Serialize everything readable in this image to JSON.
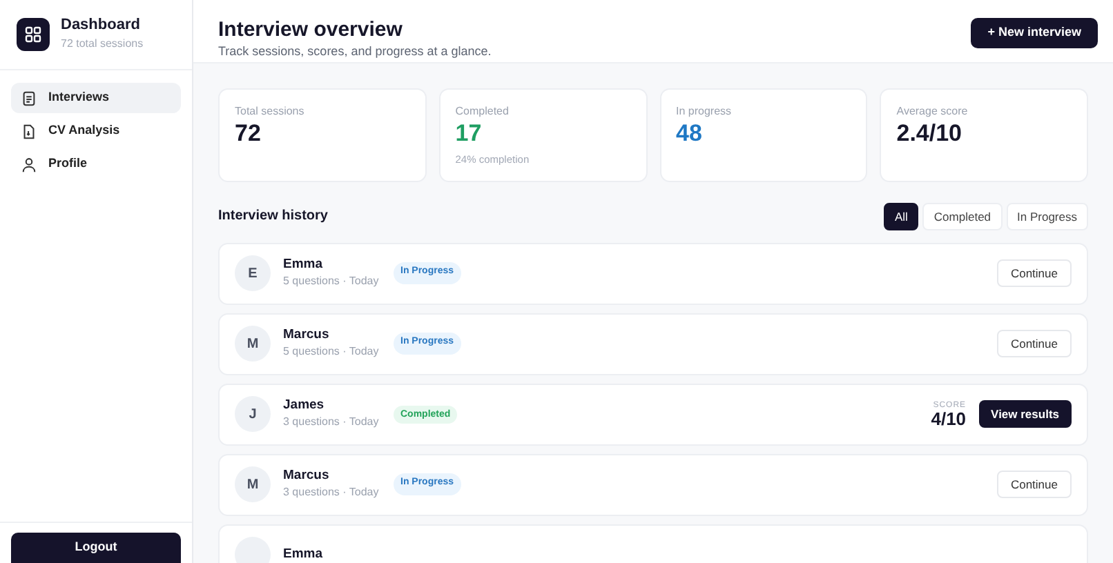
{
  "sidebar": {
    "title": "Dashboard",
    "subtitle": "72 total sessions",
    "items": [
      {
        "label": "Interviews",
        "selected": true
      },
      {
        "label": "CV Analysis",
        "selected": false
      },
      {
        "label": "Profile",
        "selected": false
      }
    ],
    "logout": "Logout"
  },
  "header": {
    "title": "Interview overview",
    "subtitle": "Track sessions, scores, and progress at a glance.",
    "action": "+ New interview"
  },
  "stats": [
    {
      "label": "Total sessions",
      "value": "72",
      "color": "#161629"
    },
    {
      "label": "Completed",
      "value": "17",
      "color": "#1f9e62",
      "note": "24% completion"
    },
    {
      "label": "In progress",
      "value": "48",
      "color": "#1f78c4"
    },
    {
      "label": "Average score",
      "value": "2.4/10",
      "color": "#161629"
    }
  ],
  "history": {
    "title": "Interview history",
    "filters": [
      {
        "label": "All",
        "selected": true
      },
      {
        "label": "Completed",
        "selected": false
      },
      {
        "label": "In Progress",
        "selected": false
      }
    ],
    "rows": [
      {
        "initial": "E",
        "name": "Emma",
        "meta": "5 questions · Today",
        "status": "In Progress",
        "kind": "progress",
        "action": "Continue"
      },
      {
        "initial": "M",
        "name": "Marcus",
        "meta": "5 questions · Today",
        "status": "In Progress",
        "kind": "progress",
        "action": "Continue"
      },
      {
        "initial": "J",
        "name": "James",
        "meta": "3 questions · Today",
        "status": "Completed",
        "kind": "completed",
        "score_label": "SCORE",
        "score": "4/10",
        "action": "View results"
      },
      {
        "initial": "M",
        "name": "Marcus",
        "meta": "3 questions · Today",
        "status": "In Progress",
        "kind": "progress",
        "action": "Continue"
      },
      {
        "name": "Emma"
      }
    ]
  }
}
